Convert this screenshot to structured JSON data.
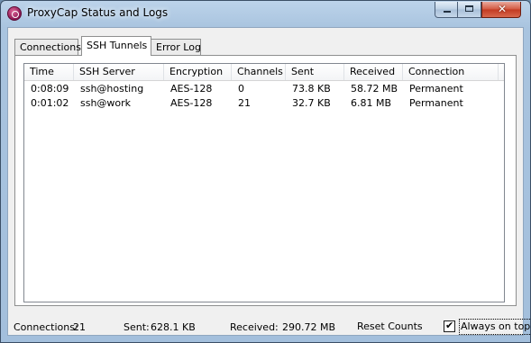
{
  "window": {
    "title": "ProxyCap Status and Logs",
    "close_glyph": "✕"
  },
  "tabs": [
    {
      "label": "Connections",
      "active": false
    },
    {
      "label": "SSH Tunnels",
      "active": true
    },
    {
      "label": "Error Log",
      "active": false
    }
  ],
  "table": {
    "columns": [
      "Time",
      "SSH Server",
      "Encryption",
      "Channels",
      "Sent",
      "Received",
      "Connection"
    ],
    "rows": [
      [
        "0:08:09",
        "ssh@hosting",
        "AES-128",
        "0",
        "73.8 KB",
        "58.72 MB",
        "Permanent"
      ],
      [
        "0:01:02",
        "ssh@work",
        "AES-128",
        "21",
        "32.7 KB",
        "6.81 MB",
        "Permanent"
      ]
    ]
  },
  "status": {
    "connections_label": "Connections:",
    "connections_value": "21",
    "sent_label": "Sent:",
    "sent_value": "628.1 KB",
    "received_label": "Received:",
    "received_value": "290.72 MB",
    "reset_label": "Reset Counts",
    "always_on_top_label": "Always on top",
    "always_on_top_checked": true
  }
}
